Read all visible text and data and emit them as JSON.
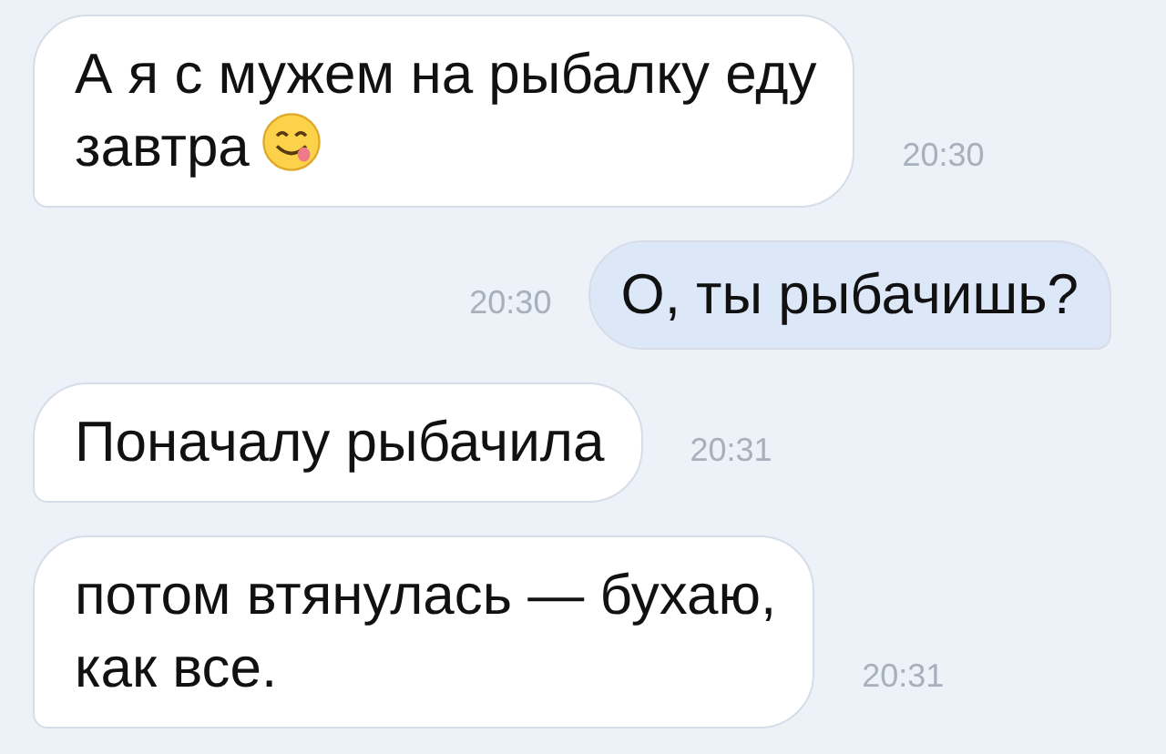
{
  "messages": [
    {
      "kind": "incoming",
      "text": "А я с мужем на рыбалку еду\nзавтра",
      "emoji": true,
      "time": "20:30"
    },
    {
      "kind": "outgoing",
      "text": "О, ты рыбачишь?",
      "emoji": false,
      "time": "20:30"
    },
    {
      "kind": "incoming",
      "text": "Поначалу рыбачила",
      "emoji": false,
      "time": "20:31"
    },
    {
      "kind": "incoming",
      "text": "потом втянулась — бухаю,\nкак все.",
      "emoji": false,
      "time": "20:31"
    }
  ]
}
